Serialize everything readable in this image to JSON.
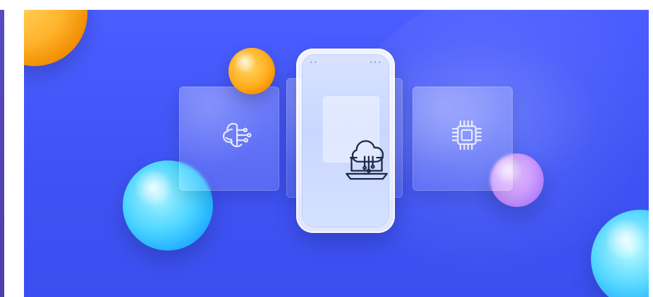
{
  "banner": {
    "palette": {
      "background_blue_1": "#4b5dff",
      "background_blue_2": "#3f53f4",
      "glass_white": "#ffffff",
      "icon_dark": "#1e2a44",
      "icon_light": "#f4f7ff"
    },
    "icons": {
      "left_card": "brain-circuit-icon",
      "center_panel": "cloud-laptop-icon",
      "right_card": "microchip-icon"
    },
    "decorations": {
      "spheres": [
        "orange-sphere",
        "orange-sphere-small",
        "cyan-sphere",
        "lilac-sphere",
        "cyan-sphere"
      ]
    }
  }
}
